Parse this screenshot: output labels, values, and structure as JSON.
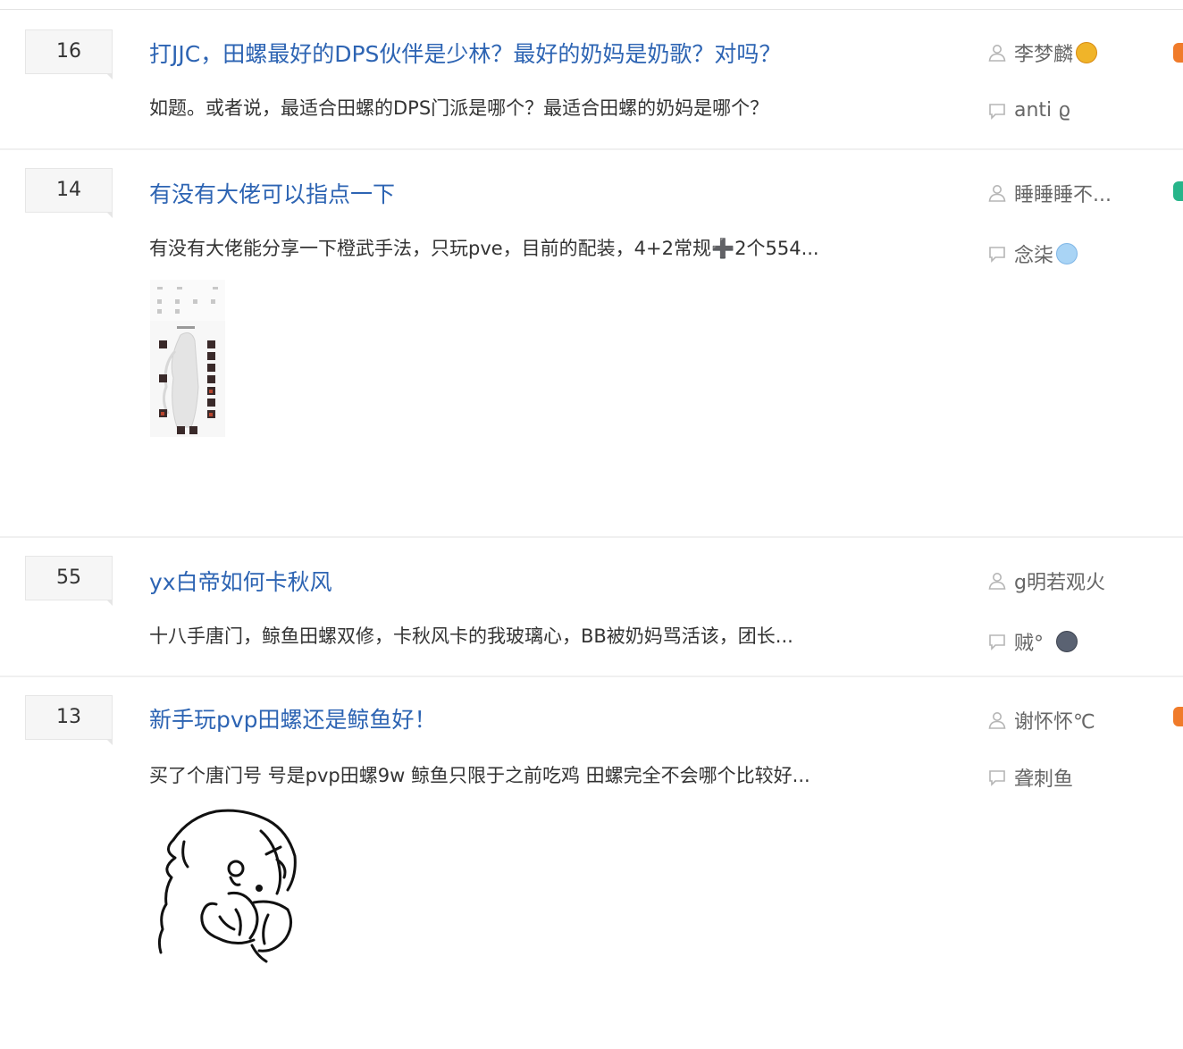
{
  "threads": [
    {
      "reply_count": "16",
      "title": "打JJC，田螺最好的DPS伙伴是少林？最好的奶妈是奶歌？对吗？",
      "excerpt": "如题。或者说，最适合田螺的DPS门派是哪个？最适合田螺的奶妈是哪个？",
      "author": "李梦麟",
      "last_reply": "anti ϱ"
    },
    {
      "reply_count": "14",
      "title": "有没有大佬可以指点一下",
      "excerpt": "有没有大佬能分享一下橙武手法，只玩pve，目前的配装，4+2常规➕2个554...",
      "author": "睡睡睡不...",
      "last_reply": "念柒"
    },
    {
      "reply_count": "55",
      "title": "yx白帝如何卡秋风",
      "excerpt": "十八手唐门，鲸鱼田螺双修，卡秋风卡的我玻璃心，BB被奶妈骂活该，团长...",
      "author": "g明若观火",
      "last_reply": "贼°"
    },
    {
      "reply_count": "13",
      "title": "新手玩pvp田螺还是鲸鱼好！",
      "excerpt": "买了个唐门号 号是pvp田螺9w 鲸鱼只限于之前吃鸡 田螺完全不会哪个比较好...",
      "author": "谢怀怀℃",
      "last_reply": "聋刺鱼"
    }
  ],
  "icons": {
    "author": "user-icon",
    "last_reply": "comment-icon"
  },
  "colors": {
    "title": "#2d64b3",
    "text": "#333333",
    "meta": "#666666"
  }
}
